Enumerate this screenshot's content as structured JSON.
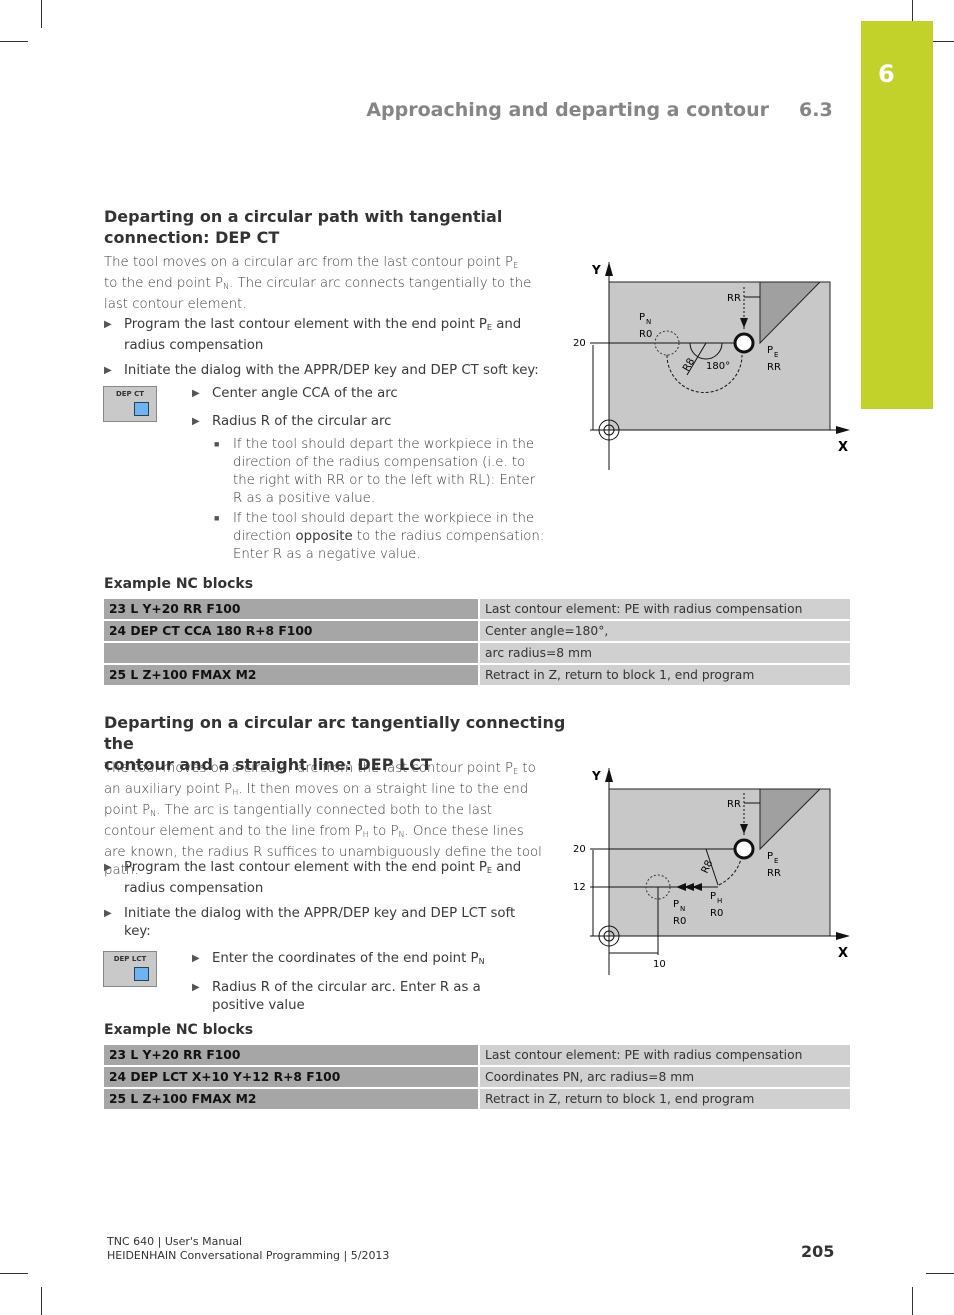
{
  "chapter_tab": "6",
  "header": {
    "title": "Approaching and departing a contour",
    "section": "6.3"
  },
  "section1": {
    "title_line1": "Departing on a circular path with tangential",
    "title_line2": "connection: DEP CT",
    "intro": [
      "The tool moves on a circular arc from the last contour point P",
      "E",
      " to the end point P",
      "N",
      ". The circular arc connects tangentially to the last contour element."
    ],
    "bullet1": [
      "Program the last contour element with the end point P",
      "E",
      " and radius compensation"
    ],
    "bullet2": "Initiate the dialog with the APPR/DEP key and DEP CT soft key:",
    "softkey_label": "DEP CT",
    "sub1": "Center angle CCA of the arc",
    "sub2": "Radius R of the circular arc",
    "sq1": "If the tool should depart the workpiece in the direction of the radius compensation (i.e. to the right with RR or to the left with RL): Enter R as a positive value.",
    "sq2_pre": "If the tool should depart the workpiece in the direction ",
    "sq2_bold": "opposite",
    "sq2_post": " to the radius compensation: Enter R as a negative value.",
    "example_title": "Example NC blocks",
    "rows": [
      {
        "code": "23 L Y+20 RR F100",
        "desc": "Last contour element: PE with radius compensation"
      },
      {
        "code": "24 DEP CT CCA 180 R+8 F100",
        "desc": "Center angle=180°,"
      },
      {
        "code": "",
        "desc": "arc radius=8 mm"
      },
      {
        "code": "25 L Z+100 FMAX M2",
        "desc": "Retract in Z, return to block 1, end program"
      }
    ],
    "diagram": {
      "y": "Y",
      "x": "X",
      "y20": "20",
      "rr_top": "RR",
      "pn": "P",
      "pn_sub": "N",
      "r0": "R0",
      "r8": "R8",
      "angle": "180°",
      "pe": "P",
      "pe_sub": "E",
      "rr": "RR"
    }
  },
  "section2": {
    "title_line1": "Departing on a circular arc tangentially connecting the",
    "title_line2": "contour and a straight line: DEP LCT",
    "intro": [
      "The tool moves on a circular arc from the last contour point P",
      "E",
      " to an auxiliary point P",
      "H",
      ". It then moves on a straight line to the end point P",
      "N",
      ". The arc is tangentially connected both to the last contour element and to the line from P",
      "H",
      " to P",
      "N",
      ". Once these lines are known, the radius R suffices to unambiguously define the tool path."
    ],
    "bullet1": [
      "Program the last contour element with the end point P",
      "E",
      " and radius compensation"
    ],
    "bullet2": "Initiate the dialog with the APPR/DEP key and DEP LCT soft key:",
    "softkey_label": "DEP LCT",
    "sub1": [
      "Enter the coordinates of the end point P",
      "N"
    ],
    "sub2": "Radius R of the circular arc. Enter R as a positive value",
    "example_title": "Example NC blocks",
    "rows": [
      {
        "code": "23 L Y+20 RR F100",
        "desc": "Last contour element: PE with radius compensation"
      },
      {
        "code": "24 DEP LCT X+10 Y+12 R+8 F100",
        "desc": "Coordinates PN, arc radius=8 mm"
      },
      {
        "code": "25 L Z+100 FMAX M2",
        "desc": "Retract in Z, return to block 1, end program"
      }
    ],
    "diagram": {
      "y": "Y",
      "x": "X",
      "y20": "20",
      "y12": "12",
      "x10": "10",
      "rr_top": "RR",
      "r8": "R8",
      "pe": "P",
      "pe_sub": "E",
      "rr": "RR",
      "pn": "P",
      "pn_sub": "N",
      "pn_r0": "R0",
      "ph": "P",
      "ph_sub": "H",
      "ph_r0": "R0"
    }
  },
  "footer": {
    "line1": "TNC 640 | User's Manual",
    "line2": "HEIDENHAIN Conversational Programming | 5/2013",
    "page": "205"
  },
  "colors": {
    "chapter_green": "#c3d22b",
    "code_cell": "#a7a6a6",
    "desc_cell": "#d0d0d0",
    "diagram_fill": "#c8c8c8"
  }
}
